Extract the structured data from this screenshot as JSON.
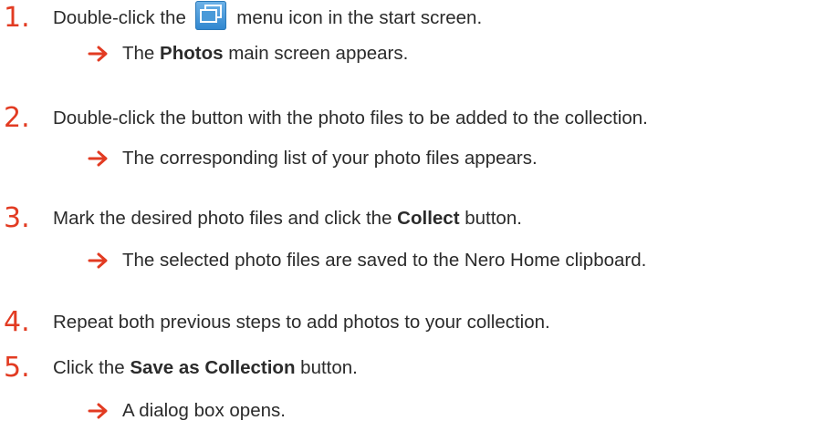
{
  "steps": [
    {
      "number": "1.",
      "before_icon": "Double-click the",
      "icon": "photos-menu-icon",
      "after_icon": " menu icon in the start screen.",
      "result": {
        "before": "The ",
        "bold": "Photos",
        "after": " main screen appears."
      }
    },
    {
      "number": "2.",
      "text": "Double-click the button with the photo files to be added to the collection.",
      "result": {
        "text": "The corresponding list of your photo files appears."
      }
    },
    {
      "number": "3.",
      "before": "Mark the desired photo files and click the ",
      "bold": "Collect",
      "after": " button.",
      "result": {
        "text": "The selected photo files are saved to the Nero Home clipboard."
      }
    },
    {
      "number": "4.",
      "text": "Repeat both previous steps to add photos to your collection."
    },
    {
      "number": "5.",
      "before": "Click the ",
      "bold": "Save as Collection",
      "after": " button.",
      "result": {
        "text": "A dialog box opens."
      }
    }
  ],
  "colors": {
    "accent": "#e23b22",
    "text": "#2b2b2b",
    "icon": "#2f86cf"
  }
}
